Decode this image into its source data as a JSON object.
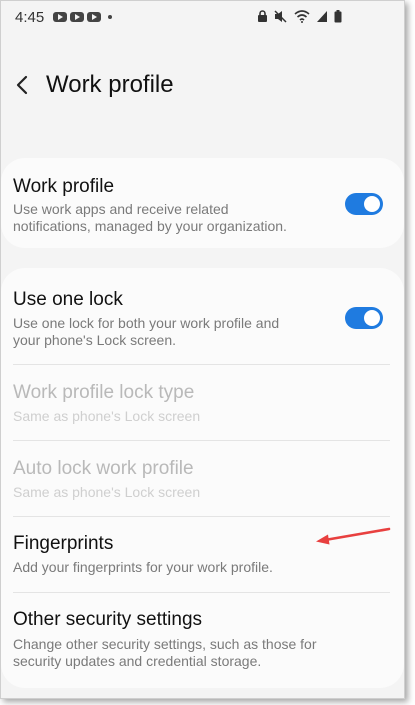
{
  "statusbar": {
    "time": "4:45",
    "icons_left": [
      "youtube-icon",
      "youtube-icon",
      "youtube-icon",
      "notification-dot-icon"
    ],
    "icons_right": [
      "lock-icon",
      "mute-icon",
      "wifi-icon",
      "signal-icon",
      "battery-icon"
    ]
  },
  "header": {
    "title": "Work profile",
    "back_icon": "chevron-left-icon"
  },
  "work_profile": {
    "title": "Work profile",
    "subtitle_line1": "Use work apps and receive related",
    "subtitle_line2": "notifications, managed by your organization.",
    "toggle_on": true
  },
  "settings": {
    "use_one_lock": {
      "title": "Use one lock",
      "subtitle_line1": "Use one lock for both your work profile and",
      "subtitle_line2": "your phone's Lock screen.",
      "toggle_on": true
    },
    "lock_type": {
      "title": "Work profile lock type",
      "subtitle": "Same as phone's Lock screen"
    },
    "auto_lock": {
      "title": "Auto lock work profile",
      "subtitle": "Same as phone's Lock screen"
    },
    "fingerprints": {
      "title": "Fingerprints",
      "subtitle": "Add your fingerprints for your work profile."
    },
    "other_security": {
      "title": "Other security settings",
      "subtitle_line1": "Change other security settings, such as those for",
      "subtitle_line2": "security updates and credential storage."
    }
  },
  "colors": {
    "toggle_on": "#1f7be0",
    "annotation_arrow": "#e8403f",
    "background": "#f4f4f4"
  }
}
